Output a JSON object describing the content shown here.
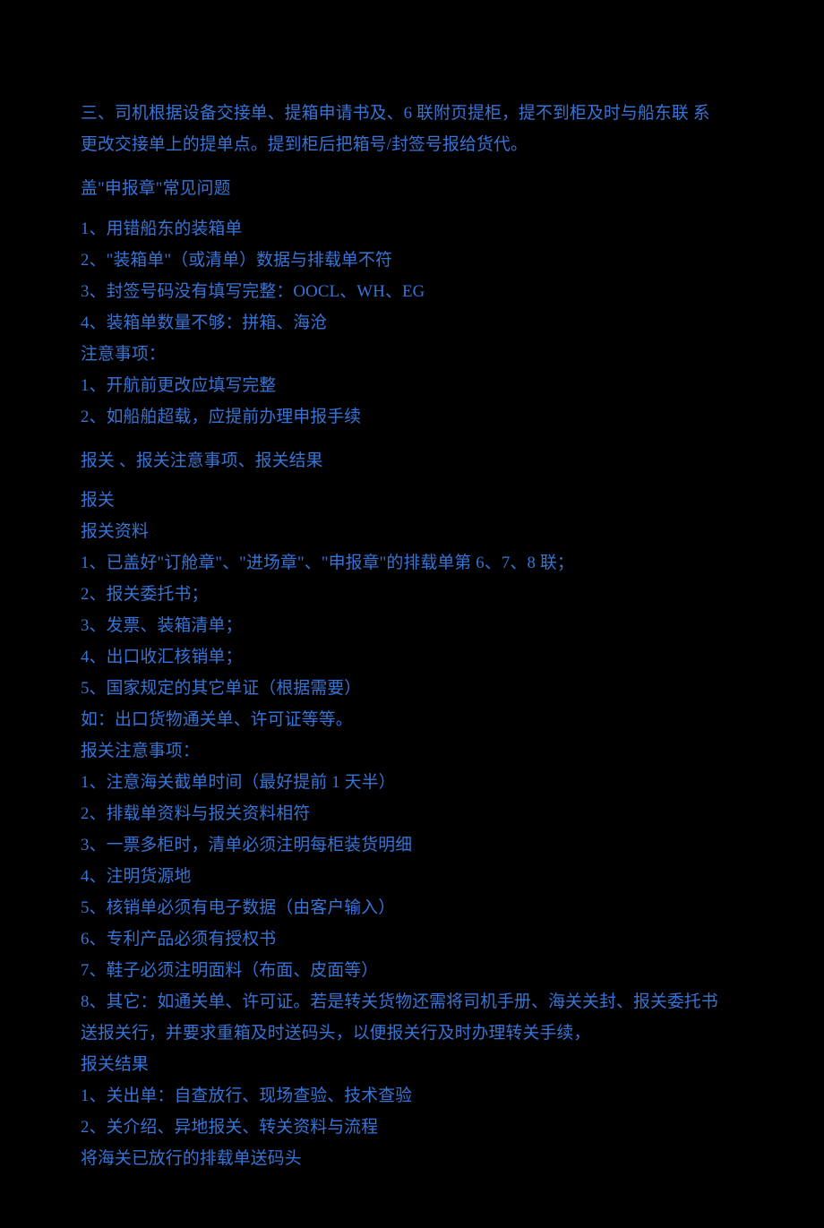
{
  "lines": {
    "l01a": "三、司机根据设备交接单、提箱申请书及、6 联附页提柜，提不到柜及时与船东联  系",
    "l01b": "更改交接单上的提单点。提到柜后把箱号/封签号报给货代。",
    "l02": "盖\"申报章\"常见问题",
    "l03": "1、用错船东的装箱单",
    "l04": "2、\"装箱单\"（或清单）数据与排载单不符",
    "l05": "3、封签号码没有填写完整：OOCL、WH、EG",
    "l06": "4、装箱单数量不够：拼箱、海沧",
    "l07": "注意事项：",
    "l08": "1、开航前更改应填写完整",
    "l09": "2、如船舶超载，应提前办理申报手续",
    "l10": "报关 、报关注意事项、报关结果",
    "l11": "报关",
    "l12": "报关资料",
    "l13": "1、已盖好\"订舱章\"、\"进场章\"、\"申报章\"的排载单第 6、7、8 联；",
    "l14": "2、报关委托书；",
    "l15": "3、发票、装箱清单；",
    "l16": "4、出口收汇核销单；",
    "l17": "5、国家规定的其它单证（根据需要）",
    "l18": "如：出口货物通关单、许可证等等。",
    "l19": "报关注意事项：",
    "l20": "1、注意海关截单时间（最好提前 1 天半）",
    "l21": "2、排载单资料与报关资料相符",
    "l22": "3、一票多柜时，清单必须注明每柜装货明细",
    "l23": "4、注明货源地",
    "l24": "5、核销单必须有电子数据（由客户输入）",
    "l25": "6、专利产品必须有授权书",
    "l26": "7、鞋子必须注明面料（布面、皮面等）",
    "l27a": "8、其它：如通关单、许可证。若是转关货物还需将司机手册、海关关封、报关委托书",
    "l27b": "送报关行，并要求重箱及时送码头，以便报关行及时办理转关手续，",
    "l28": "报关结果",
    "l29": "1、关出单：自查放行、现场查验、技术查验",
    "l30": "2、关介绍、异地报关、转关资料与流程",
    "l31": "将海关已放行的排载单送码头"
  }
}
